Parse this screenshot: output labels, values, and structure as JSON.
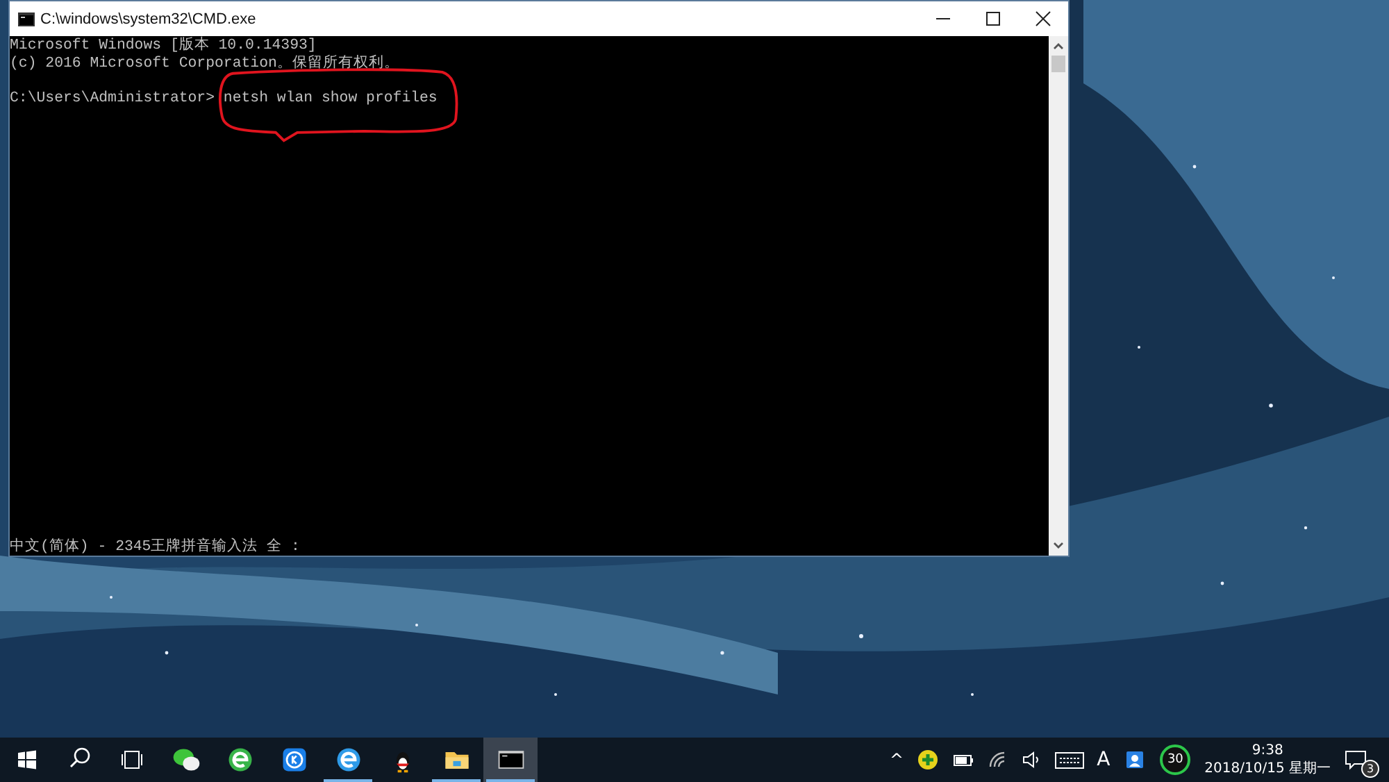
{
  "window": {
    "title": "C:\\windows\\system32\\CMD.exe",
    "console_lines": [
      "Microsoft Windows [版本 10.0.14393]",
      "(c) 2016 Microsoft Corporation。保留所有权利。"
    ],
    "prompt_line": "C:\\Users\\Administrator> netsh wlan show profiles",
    "ime_status": "中文(简体) - 2345王牌拼音输入法 全 :"
  },
  "annotation": {
    "kind": "ellipse",
    "color": "#e0141e"
  },
  "taskbar": {
    "apps": [
      {
        "kind": "wechat",
        "running": false,
        "selected": false
      },
      {
        "kind": "green-browser",
        "running": false,
        "selected": false
      },
      {
        "kind": "k-app",
        "running": false,
        "selected": false
      },
      {
        "kind": "ie",
        "running": true,
        "selected": false
      },
      {
        "kind": "penguin",
        "running": false,
        "selected": false
      },
      {
        "kind": "folder",
        "running": true,
        "selected": false
      },
      {
        "kind": "cmd",
        "running": true,
        "selected": true
      }
    ],
    "tray": {
      "chevron": "^",
      "ime": "A",
      "badge": "30",
      "time": "9:38",
      "date": "2018/10/15 星期一",
      "notifications": "3"
    }
  }
}
